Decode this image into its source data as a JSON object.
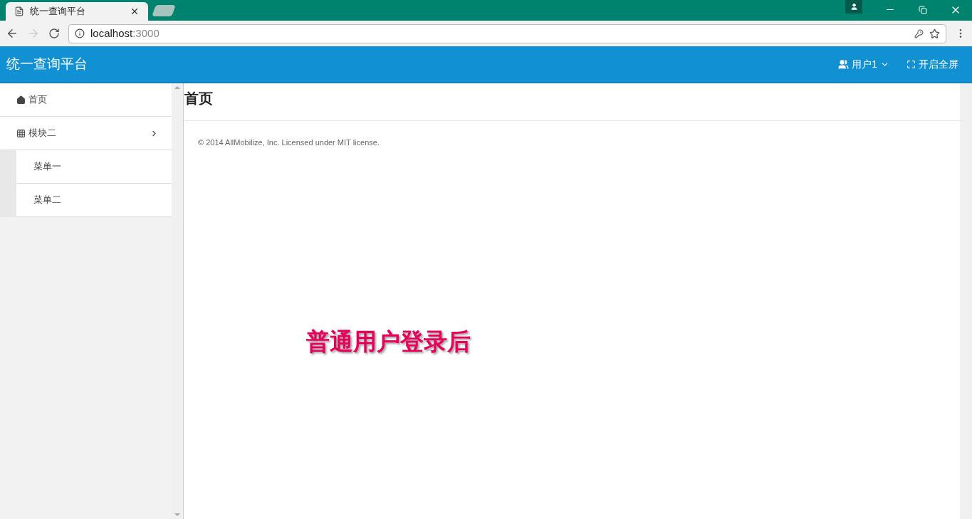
{
  "browser": {
    "tabs": [
      {
        "title": "统一查询平台",
        "selected": true
      },
      {
        "selected": false
      }
    ],
    "address": {
      "host": "localhost",
      "port": ":3000"
    }
  },
  "header": {
    "brand": "统一查询平台",
    "user_menu": "用户1",
    "fullscreen": "开启全屏"
  },
  "sidebar": {
    "items": [
      {
        "kind": "link",
        "label": "首页"
      },
      {
        "kind": "group",
        "label": "模块二",
        "expanded": true,
        "children": [
          {
            "label": "菜单一"
          },
          {
            "label": "菜单二"
          }
        ]
      }
    ]
  },
  "main": {
    "title": "首页",
    "footer": "© 2014 AllMobilize, Inc. Licensed under MIT license."
  },
  "annotation": "普通用户登录后"
}
